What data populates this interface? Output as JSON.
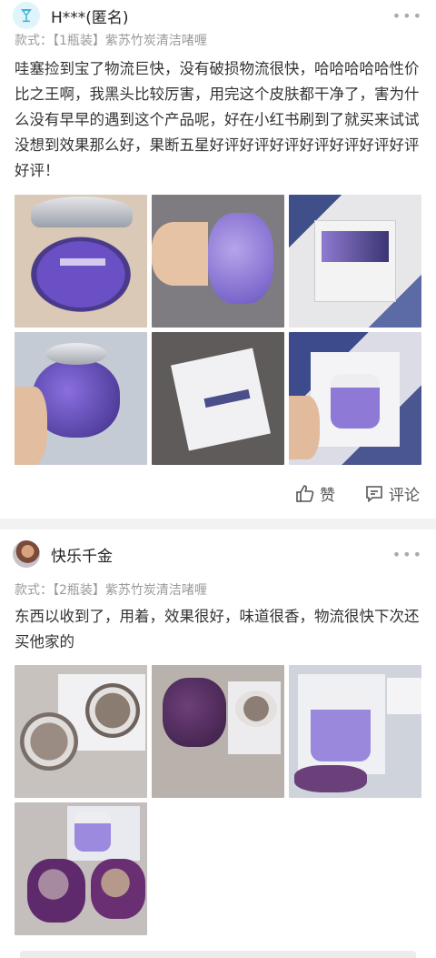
{
  "reviews": [
    {
      "username": "H***(匿名)",
      "avatar_icon": "heart-cup-icon",
      "spec_label": "款式：",
      "spec_value": "【1瓶装】紫苏竹炭清洁啫喱",
      "content": "哇塞捡到宝了物流巨快，没有破损物流很快，哈哈哈哈哈性价比之王啊，我黑头比较厉害，用完这个皮肤都干净了，害为什么没有早早的遇到这个产品呢，好在小红书刷到了就买来试试 没想到效果那么好，果断五星好评好评好评好评好评好评好评好评！",
      "photos": [
        "photo-1",
        "photo-2",
        "photo-3",
        "photo-4",
        "photo-5",
        "photo-6"
      ],
      "like_label": "赞",
      "comment_label": "评论"
    },
    {
      "username": "快乐千金",
      "avatar_icon": "user-avatar-photo",
      "spec_label": "款式：",
      "spec_value": "【2瓶装】紫苏竹炭清洁啫喱",
      "content": "东西以收到了，用着，效果很好，味道很香，物流很快下次还买他家的",
      "photos": [
        "photo-1",
        "photo-2",
        "photo-3",
        "photo-4"
      ]
    }
  ],
  "icons": {
    "more": "more-dots-icon",
    "like": "thumb-up-icon",
    "comment": "comment-icon"
  },
  "colors": {
    "text_primary": "#333333",
    "text_secondary": "#999999",
    "avatar_bg": "#dff4fb",
    "avatar_accent": "#45b6d8"
  }
}
